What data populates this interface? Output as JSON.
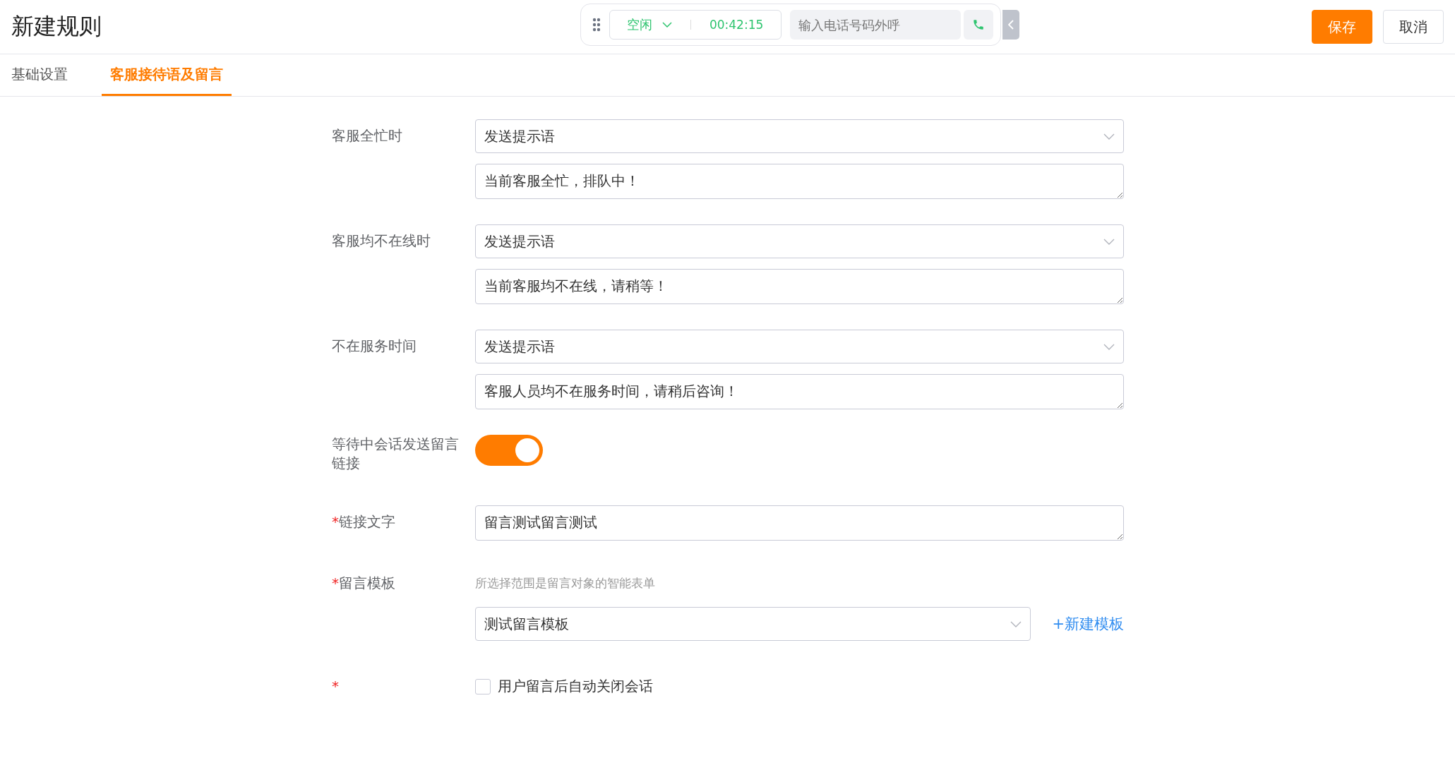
{
  "page": {
    "title": "新建规则"
  },
  "call_bar": {
    "status": "空闲",
    "timer": "00:42:15",
    "phone_placeholder": "输入电话号码外呼"
  },
  "actions": [
    {
      "label": "保存",
      "kind": "primary"
    },
    {
      "label": "取消",
      "kind": "default"
    }
  ],
  "tabs": [
    {
      "label": "基础设置",
      "selected": false
    },
    {
      "label": "客服接待语及留言",
      "selected": true
    }
  ],
  "form": [
    {
      "kind": "select_text",
      "label": "客服全忙时",
      "select": "发送提示语",
      "text": "当前客服全忙，排队中！"
    },
    {
      "kind": "select_text",
      "label": "客服均不在线时",
      "select": "发送提示语",
      "text": "当前客服均不在线，请稍等！"
    },
    {
      "kind": "select_text",
      "label": "不在服务时间",
      "select": "发送提示语",
      "text": "客服人员均不在服务时间，请稍后咨询！"
    },
    {
      "kind": "switch",
      "label": "等待中会话发送留言链接",
      "on": true
    },
    {
      "kind": "text",
      "required_mark": "*",
      "label": "链接文字",
      "text": "留言测试留言测试"
    },
    {
      "kind": "template",
      "required_mark": "*",
      "label": "留言模板",
      "hint": "所选择范围是留言对象的智能表单",
      "select": "测试留言模板",
      "link": "+新建模板"
    },
    {
      "kind": "checkbox",
      "required_mark": "*",
      "checked": false,
      "text": "用户留言后自动关闭会话"
    }
  ]
}
